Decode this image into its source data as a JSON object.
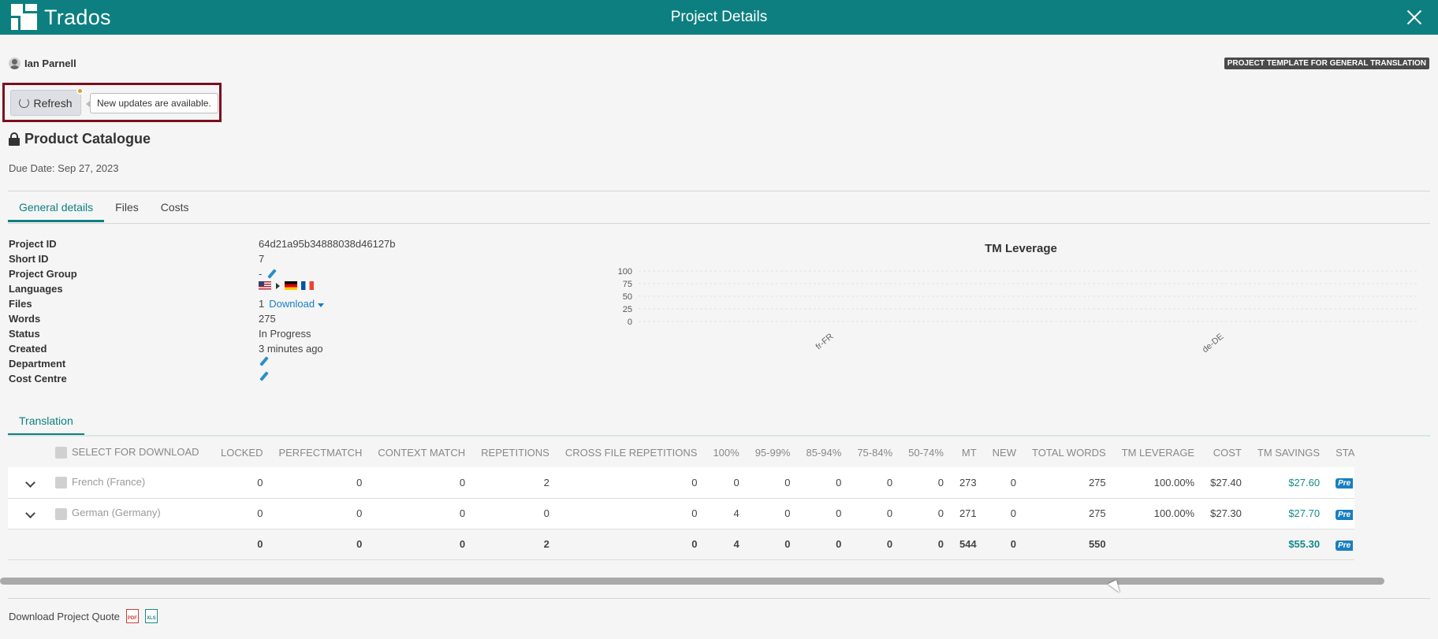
{
  "app": {
    "logo": "Trados",
    "title": "Project Details"
  },
  "user": {
    "name": "Ian Parnell"
  },
  "template_badge": "PROJECT TEMPLATE FOR GENERAL TRANSLATION",
  "refresh": {
    "label": "Refresh",
    "tooltip": "New updates are available."
  },
  "project": {
    "name": "Product Catalogue",
    "due_date": "Due Date: Sep 27, 2023"
  },
  "tabs": [
    {
      "label": "General details"
    },
    {
      "label": "Files"
    },
    {
      "label": "Costs"
    }
  ],
  "details": {
    "project_id": {
      "label": "Project ID",
      "value": "64d21a95b34888038d46127b"
    },
    "short_id": {
      "label": "Short ID",
      "value": "7"
    },
    "project_group": {
      "label": "Project Group",
      "value": "-"
    },
    "languages": {
      "label": "Languages"
    },
    "files": {
      "label": "Files",
      "value": "1",
      "link": "Download"
    },
    "words": {
      "label": "Words",
      "value": "275"
    },
    "status": {
      "label": "Status",
      "value": "In Progress"
    },
    "created": {
      "label": "Created",
      "value": "3 minutes ago"
    },
    "department": {
      "label": "Department"
    },
    "cost_centre": {
      "label": "Cost Centre"
    }
  },
  "chart_data": {
    "type": "bar",
    "title": "TM Leverage",
    "categories": [
      "fr-FR",
      "de-DE"
    ],
    "values": [
      0,
      0
    ],
    "yticks": [
      "100",
      "75",
      "50",
      "25",
      "0"
    ],
    "ylim": [
      0,
      100
    ],
    "grid": true
  },
  "subtab": {
    "label": "Translation"
  },
  "table": {
    "headers": [
      "SELECT FOR DOWNLOAD",
      "LOCKED",
      "PERFECTMATCH",
      "CONTEXT MATCH",
      "REPETITIONS",
      "CROSS FILE REPETITIONS",
      "100%",
      "95-99%",
      "85-94%",
      "75-84%",
      "50-74%",
      "MT",
      "NEW",
      "TOTAL WORDS",
      "TM LEVERAGE",
      "COST",
      "TM SAVINGS",
      "STA"
    ],
    "rows": [
      {
        "lang": "French (France)",
        "cells": [
          "0",
          "0",
          "0",
          "2",
          "0",
          "0",
          "0",
          "0",
          "0",
          "0",
          "273",
          "0",
          "275",
          "100.00%",
          "$27.40"
        ],
        "savings": "$27.60",
        "status": "Pre"
      },
      {
        "lang": "German (Germany)",
        "cells": [
          "0",
          "0",
          "0",
          "0",
          "0",
          "4",
          "0",
          "0",
          "0",
          "0",
          "271",
          "0",
          "275",
          "100.00%",
          "$27.30"
        ],
        "savings": "$27.70",
        "status": "Pre"
      }
    ],
    "total": {
      "cells": [
        "0",
        "0",
        "0",
        "2",
        "0",
        "4",
        "0",
        "0",
        "0",
        "0",
        "544",
        "0",
        "550",
        "",
        ""
      ],
      "savings": "$55.30",
      "status": "Pre"
    }
  },
  "quote": {
    "label": "Download Project Quote",
    "pdf": "PDF",
    "xls": "XLS"
  },
  "colors": {
    "brand": "#0e7f80",
    "highlight_border": "#7b0f1d",
    "link": "#1a7fc0"
  }
}
